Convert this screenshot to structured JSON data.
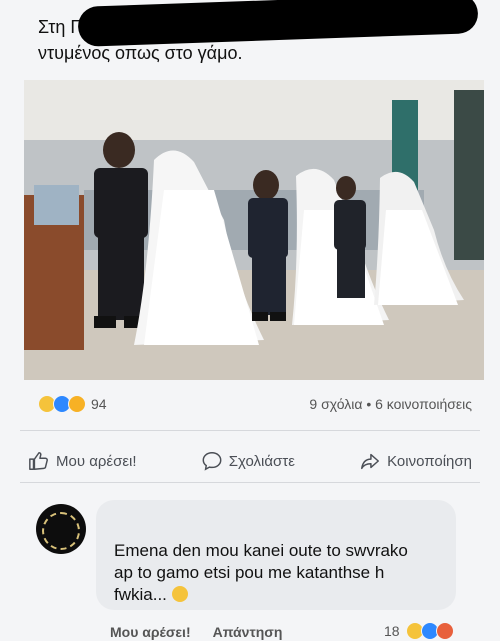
{
  "post": {
    "text": "Στη Γκάνα την ήμερα του διαζυγίου πρεπει να είσαι ντυμένος οπως στο γάμο."
  },
  "reactions": {
    "icons": [
      "haha-emoji-icon",
      "like-icon",
      "wow-emoji-icon"
    ],
    "count": "94"
  },
  "stats": {
    "text": "9 σχόλια • 6 κοινοποιήσεις"
  },
  "actions": {
    "like": "Μου αρέσει!",
    "comment": "Σχολιάστε",
    "share": "Κοινοποίηση"
  },
  "comment": {
    "text": "Emena den mou kanei oute to swvrako ap to gamo etsi pou me katanthse h fwkia...",
    "emoji": "thinking-emoji-icon",
    "like_label": "Μου αρέσει!",
    "reply_label": "Απάντηση",
    "reaction_count": "18",
    "reaction_icons": [
      "haha-emoji-icon",
      "like-icon",
      "angry-emoji-icon"
    ]
  },
  "colors": {
    "accent": "#2d88ff",
    "background": "#f4f5f7",
    "bubble": "#e9ebee"
  }
}
